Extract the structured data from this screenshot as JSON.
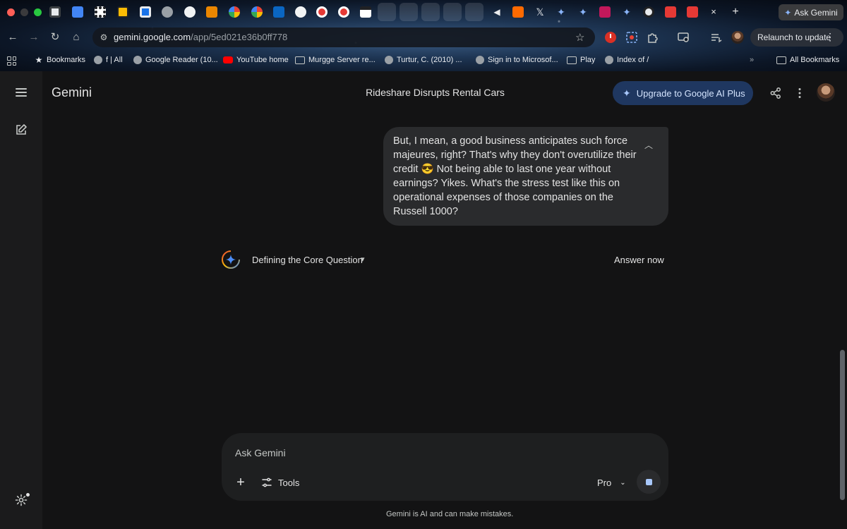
{
  "browser": {
    "tabs": {
      "new_tab_label": "+",
      "close_label": "×"
    },
    "ask_gemini": "Ask Gemini",
    "address": {
      "host": "gemini.google.com",
      "path": "/app/5ed021e36b0ff778"
    },
    "relaunch": "Relaunch to update",
    "bookmarks": [
      {
        "label": "Bookmarks",
        "icon": "star-icon"
      },
      {
        "label": "f | All",
        "icon": "globe-icon"
      },
      {
        "label": "Google Reader (10...",
        "icon": "globe-icon"
      },
      {
        "label": "YouTube home",
        "icon": "youtube-icon"
      },
      {
        "label": "Murgge Server re...",
        "icon": "folder-icon"
      },
      {
        "label": "Turtur, C. (2010) ...",
        "icon": "globe-icon"
      },
      {
        "label": "Sign in to Microsof...",
        "icon": "globe-icon"
      },
      {
        "label": "Play",
        "icon": "folder-icon"
      },
      {
        "label": "Index of /",
        "icon": "globe-icon"
      }
    ],
    "more_bookmarks": "»",
    "all_bookmarks": "All Bookmarks"
  },
  "app": {
    "brand": "Gemini",
    "title": "Rideshare Disrupts Rental Cars",
    "upgrade": "Upgrade to Google AI Plus",
    "user_message": "But, I mean, a good business anticipates such force majeures, right? That's why they don't overutilize their credit 😎 Not being able to last one year without earnings? Yikes. What's the stress test like this on operational expenses of those companies on the Russell 1000?",
    "thinking_label": "Defining the Core Question",
    "answer_now": "Answer now",
    "composer": {
      "placeholder": "Ask Gemini",
      "tools": "Tools",
      "model": "Pro"
    },
    "disclaimer": "Gemini is AI and can make mistakes."
  },
  "colors": {
    "background": "#131314",
    "rail": "#1b1b1c",
    "bubble": "#2a2b2d",
    "upgrade_bg": "#1f3760",
    "accent": "#a8c7fa"
  }
}
